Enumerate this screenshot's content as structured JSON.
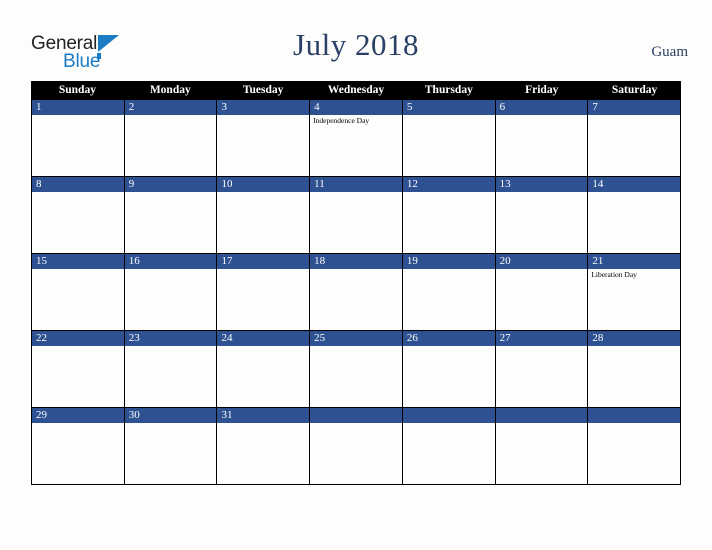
{
  "brand": {
    "name_part1": "General",
    "name_part2": "Blue",
    "triangle_color": "#1b7bc4",
    "text_color": "#231f20"
  },
  "header": {
    "title": "July 2018",
    "country": "Guam",
    "title_color": "#2b4066"
  },
  "calendar": {
    "weekday_headers": [
      "Sunday",
      "Monday",
      "Tuesday",
      "Wednesday",
      "Thursday",
      "Friday",
      "Saturday"
    ],
    "header_bg": "#000000",
    "date_bar_color": "#2e5291",
    "weeks": [
      [
        {
          "date": "1",
          "events": []
        },
        {
          "date": "2",
          "events": []
        },
        {
          "date": "3",
          "events": []
        },
        {
          "date": "4",
          "events": [
            "Independence Day"
          ]
        },
        {
          "date": "5",
          "events": []
        },
        {
          "date": "6",
          "events": []
        },
        {
          "date": "7",
          "events": []
        }
      ],
      [
        {
          "date": "8",
          "events": []
        },
        {
          "date": "9",
          "events": []
        },
        {
          "date": "10",
          "events": []
        },
        {
          "date": "11",
          "events": []
        },
        {
          "date": "12",
          "events": []
        },
        {
          "date": "13",
          "events": []
        },
        {
          "date": "14",
          "events": []
        }
      ],
      [
        {
          "date": "15",
          "events": []
        },
        {
          "date": "16",
          "events": []
        },
        {
          "date": "17",
          "events": []
        },
        {
          "date": "18",
          "events": []
        },
        {
          "date": "19",
          "events": []
        },
        {
          "date": "20",
          "events": []
        },
        {
          "date": "21",
          "events": [
            "Liberation Day"
          ]
        }
      ],
      [
        {
          "date": "22",
          "events": []
        },
        {
          "date": "23",
          "events": []
        },
        {
          "date": "24",
          "events": []
        },
        {
          "date": "25",
          "events": []
        },
        {
          "date": "26",
          "events": []
        },
        {
          "date": "27",
          "events": []
        },
        {
          "date": "28",
          "events": []
        }
      ],
      [
        {
          "date": "29",
          "events": []
        },
        {
          "date": "30",
          "events": []
        },
        {
          "date": "31",
          "events": []
        },
        {
          "date": "",
          "events": []
        },
        {
          "date": "",
          "events": []
        },
        {
          "date": "",
          "events": []
        },
        {
          "date": "",
          "events": []
        }
      ]
    ]
  }
}
